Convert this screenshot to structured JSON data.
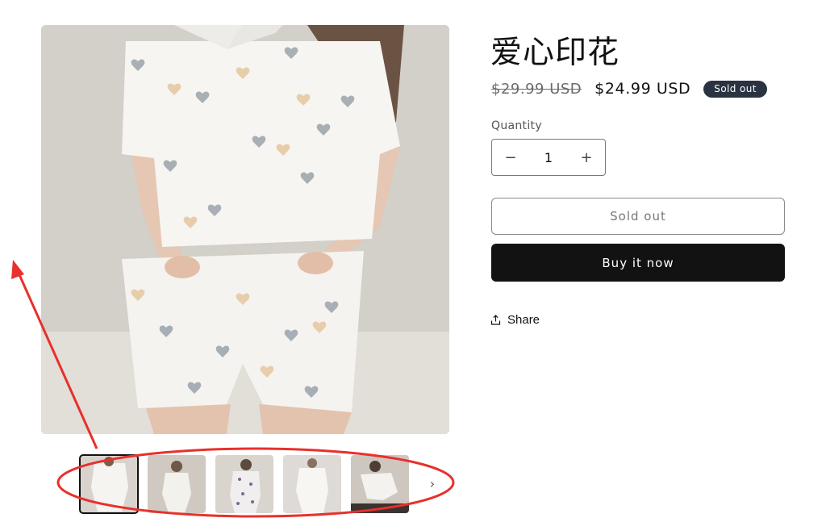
{
  "product": {
    "title": "爱心印花",
    "compare_price": "$29.99 USD",
    "sale_price": "$24.99 USD",
    "badge": "Sold out"
  },
  "quantity": {
    "label": "Quantity",
    "value": "1",
    "decrease": "−",
    "increase": "+"
  },
  "buttons": {
    "sold_out": "Sold out",
    "buy_now": "Buy it now",
    "share": "Share"
  },
  "gallery": {
    "thumbnail_count": 5,
    "active_thumbnail": 1,
    "next_icon": "chevron-right-icon"
  },
  "colors": {
    "accent_dark": "#121212",
    "badge_bg": "#2a3342",
    "annotation_red": "#e8302c"
  }
}
